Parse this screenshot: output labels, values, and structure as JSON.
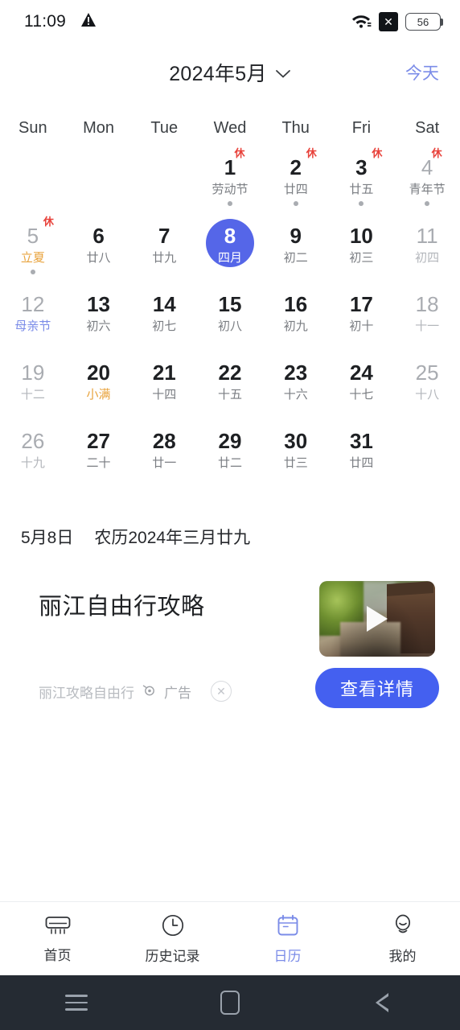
{
  "status_bar": {
    "time": "11:09",
    "warning_icon": "warning-triangle-icon",
    "wifi_icon": "wifi-icon",
    "sim_icon_label": "✕",
    "battery_level": "56"
  },
  "header": {
    "month_title": "2024年5月",
    "chevron": "∨",
    "today_label": "今天"
  },
  "weekdays": [
    "Sun",
    "Mon",
    "Tue",
    "Wed",
    "Thu",
    "Fri",
    "Sat"
  ],
  "calendar": {
    "leading_blanks": 3,
    "selected_color": "#5566e8",
    "rest_badge_text": "休",
    "days": [
      {
        "num": "1",
        "lunar": "劳动节",
        "rest": true,
        "dot": true,
        "muted": false,
        "lunar_style": "normal",
        "selected": false
      },
      {
        "num": "2",
        "lunar": "廿四",
        "rest": true,
        "dot": true,
        "muted": false,
        "lunar_style": "normal",
        "selected": false
      },
      {
        "num": "3",
        "lunar": "廿五",
        "rest": true,
        "dot": true,
        "muted": false,
        "lunar_style": "normal",
        "selected": false
      },
      {
        "num": "4",
        "lunar": "青年节",
        "rest": true,
        "dot": true,
        "muted": true,
        "lunar_style": "normal",
        "selected": false
      },
      {
        "num": "5",
        "lunar": "立夏",
        "rest": true,
        "dot": true,
        "muted": true,
        "lunar_style": "term",
        "selected": false
      },
      {
        "num": "6",
        "lunar": "廿八",
        "rest": false,
        "dot": false,
        "muted": false,
        "lunar_style": "normal",
        "selected": false
      },
      {
        "num": "7",
        "lunar": "廿九",
        "rest": false,
        "dot": false,
        "muted": false,
        "lunar_style": "normal",
        "selected": false
      },
      {
        "num": "8",
        "lunar": "四月",
        "rest": false,
        "dot": false,
        "muted": false,
        "lunar_style": "normal",
        "selected": true
      },
      {
        "num": "9",
        "lunar": "初二",
        "rest": false,
        "dot": false,
        "muted": false,
        "lunar_style": "normal",
        "selected": false
      },
      {
        "num": "10",
        "lunar": "初三",
        "rest": false,
        "dot": false,
        "muted": false,
        "lunar_style": "normal",
        "selected": false
      },
      {
        "num": "11",
        "lunar": "初四",
        "rest": false,
        "dot": false,
        "muted": true,
        "lunar_style": "muted",
        "selected": false
      },
      {
        "num": "12",
        "lunar": "母亲节",
        "rest": false,
        "dot": false,
        "muted": true,
        "lunar_style": "festival",
        "selected": false
      },
      {
        "num": "13",
        "lunar": "初六",
        "rest": false,
        "dot": false,
        "muted": false,
        "lunar_style": "normal",
        "selected": false
      },
      {
        "num": "14",
        "lunar": "初七",
        "rest": false,
        "dot": false,
        "muted": false,
        "lunar_style": "normal",
        "selected": false
      },
      {
        "num": "15",
        "lunar": "初八",
        "rest": false,
        "dot": false,
        "muted": false,
        "lunar_style": "normal",
        "selected": false
      },
      {
        "num": "16",
        "lunar": "初九",
        "rest": false,
        "dot": false,
        "muted": false,
        "lunar_style": "normal",
        "selected": false
      },
      {
        "num": "17",
        "lunar": "初十",
        "rest": false,
        "dot": false,
        "muted": false,
        "lunar_style": "normal",
        "selected": false
      },
      {
        "num": "18",
        "lunar": "十一",
        "rest": false,
        "dot": false,
        "muted": true,
        "lunar_style": "muted",
        "selected": false
      },
      {
        "num": "19",
        "lunar": "十二",
        "rest": false,
        "dot": false,
        "muted": true,
        "lunar_style": "muted",
        "selected": false
      },
      {
        "num": "20",
        "lunar": "小满",
        "rest": false,
        "dot": false,
        "muted": false,
        "lunar_style": "term",
        "selected": false
      },
      {
        "num": "21",
        "lunar": "十四",
        "rest": false,
        "dot": false,
        "muted": false,
        "lunar_style": "normal",
        "selected": false
      },
      {
        "num": "22",
        "lunar": "十五",
        "rest": false,
        "dot": false,
        "muted": false,
        "lunar_style": "normal",
        "selected": false
      },
      {
        "num": "23",
        "lunar": "十六",
        "rest": false,
        "dot": false,
        "muted": false,
        "lunar_style": "normal",
        "selected": false
      },
      {
        "num": "24",
        "lunar": "十七",
        "rest": false,
        "dot": false,
        "muted": false,
        "lunar_style": "normal",
        "selected": false
      },
      {
        "num": "25",
        "lunar": "十八",
        "rest": false,
        "dot": false,
        "muted": true,
        "lunar_style": "muted",
        "selected": false
      },
      {
        "num": "26",
        "lunar": "十九",
        "rest": false,
        "dot": false,
        "muted": true,
        "lunar_style": "muted",
        "selected": false
      },
      {
        "num": "27",
        "lunar": "二十",
        "rest": false,
        "dot": false,
        "muted": false,
        "lunar_style": "normal",
        "selected": false
      },
      {
        "num": "28",
        "lunar": "廿一",
        "rest": false,
        "dot": false,
        "muted": false,
        "lunar_style": "normal",
        "selected": false
      },
      {
        "num": "29",
        "lunar": "廿二",
        "rest": false,
        "dot": false,
        "muted": false,
        "lunar_style": "normal",
        "selected": false
      },
      {
        "num": "30",
        "lunar": "廿三",
        "rest": false,
        "dot": false,
        "muted": false,
        "lunar_style": "normal",
        "selected": false
      },
      {
        "num": "31",
        "lunar": "廿四",
        "rest": false,
        "dot": false,
        "muted": false,
        "lunar_style": "normal",
        "selected": false
      }
    ]
  },
  "detail": {
    "solar_date": "5月8日",
    "lunar_date": "农历2024年三月廿九"
  },
  "ad": {
    "title": "丽江自由行攻略",
    "source": "丽江攻略自由行",
    "label": "广告",
    "close_icon": "✕",
    "cta_label": "查看详情",
    "cta_color": "#4460f0",
    "thumbnail_alt": "丽江古城街景视频"
  },
  "tabbar": {
    "items": [
      {
        "label": "首页",
        "icon": "home-ac-icon",
        "active": false
      },
      {
        "label": "历史记录",
        "icon": "clock-icon",
        "active": false
      },
      {
        "label": "日历",
        "icon": "calendar-icon",
        "active": true
      },
      {
        "label": "我的",
        "icon": "person-icon",
        "active": false
      }
    ],
    "active_color": "#7b8ce8"
  },
  "android_nav": {
    "recents": "recents-icon",
    "home": "home-icon",
    "back": "back-icon"
  }
}
